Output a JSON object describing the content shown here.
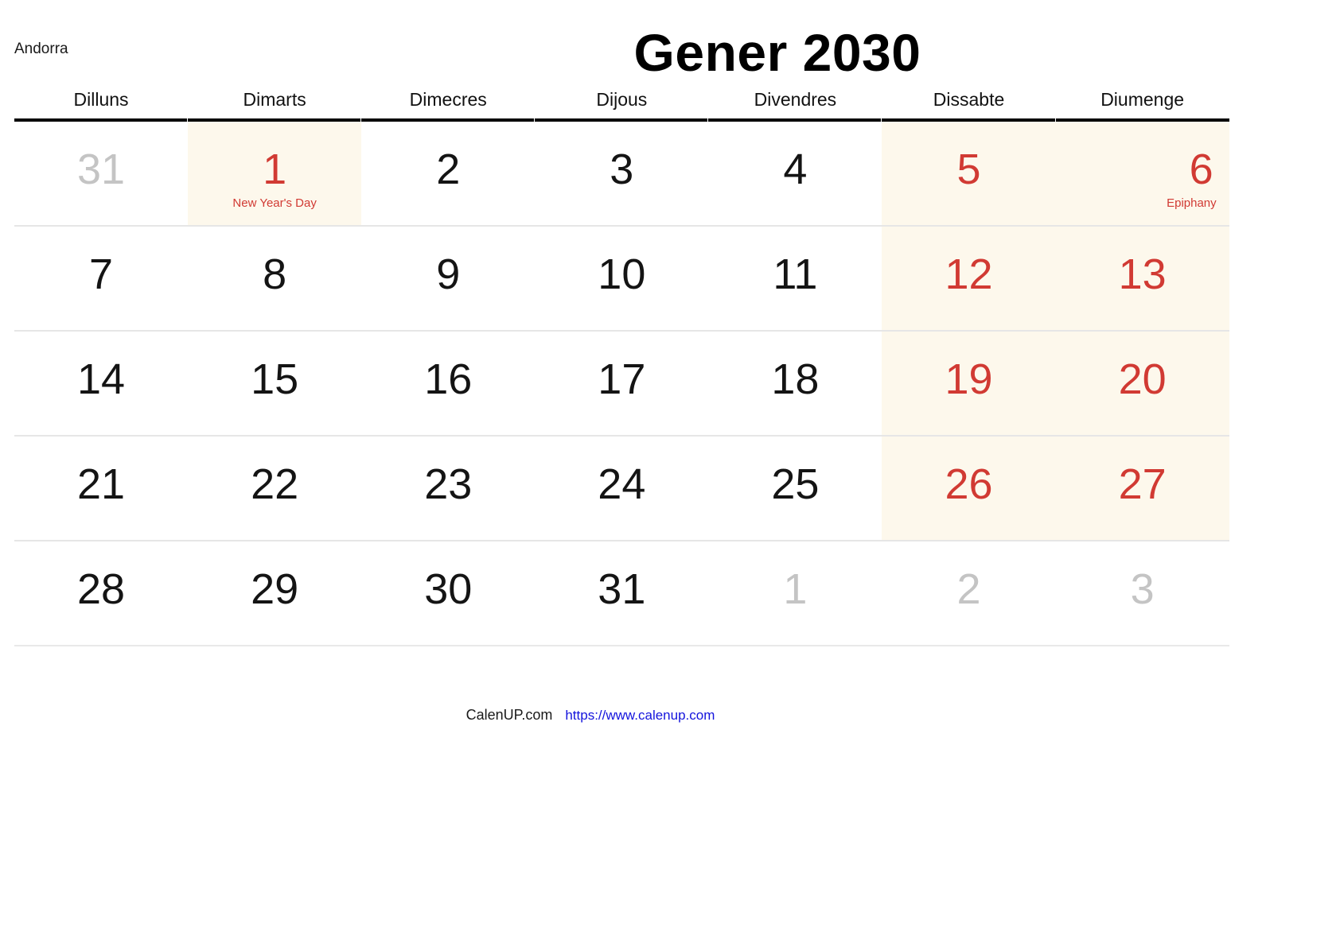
{
  "country": "Andorra",
  "title": "Gener 2030",
  "weekdays": [
    "Dilluns",
    "Dimarts",
    "Dimecres",
    "Dijous",
    "Divendres",
    "Dissabte",
    "Diumenge"
  ],
  "colors": {
    "weekend_text": "#d13a33",
    "holiday_text": "#d13a33",
    "muted_text": "#c4c4c4",
    "weekend_background": "#fdf8ec",
    "holiday_background": "#fdf8ec",
    "rule": "#000000",
    "row_divider": "#e6e6e6",
    "link": "#1414dd"
  },
  "weeks": [
    [
      {
        "day": "31",
        "muted": true,
        "weekend": false,
        "shaded": false,
        "holiday": null
      },
      {
        "day": "1",
        "muted": false,
        "weekend": false,
        "shaded": true,
        "holiday": "New Year's Day"
      },
      {
        "day": "2",
        "muted": false,
        "weekend": false,
        "shaded": false,
        "holiday": null
      },
      {
        "day": "3",
        "muted": false,
        "weekend": false,
        "shaded": false,
        "holiday": null
      },
      {
        "day": "4",
        "muted": false,
        "weekend": false,
        "shaded": false,
        "holiday": null
      },
      {
        "day": "5",
        "muted": false,
        "weekend": true,
        "shaded": true,
        "holiday": null
      },
      {
        "day": "6",
        "muted": false,
        "weekend": true,
        "shaded": true,
        "holiday": "Epiphany"
      }
    ],
    [
      {
        "day": "7",
        "muted": false,
        "weekend": false,
        "shaded": false,
        "holiday": null
      },
      {
        "day": "8",
        "muted": false,
        "weekend": false,
        "shaded": false,
        "holiday": null
      },
      {
        "day": "9",
        "muted": false,
        "weekend": false,
        "shaded": false,
        "holiday": null
      },
      {
        "day": "10",
        "muted": false,
        "weekend": false,
        "shaded": false,
        "holiday": null
      },
      {
        "day": "11",
        "muted": false,
        "weekend": false,
        "shaded": false,
        "holiday": null
      },
      {
        "day": "12",
        "muted": false,
        "weekend": true,
        "shaded": true,
        "holiday": null
      },
      {
        "day": "13",
        "muted": false,
        "weekend": true,
        "shaded": true,
        "holiday": null
      }
    ],
    [
      {
        "day": "14",
        "muted": false,
        "weekend": false,
        "shaded": false,
        "holiday": null
      },
      {
        "day": "15",
        "muted": false,
        "weekend": false,
        "shaded": false,
        "holiday": null
      },
      {
        "day": "16",
        "muted": false,
        "weekend": false,
        "shaded": false,
        "holiday": null
      },
      {
        "day": "17",
        "muted": false,
        "weekend": false,
        "shaded": false,
        "holiday": null
      },
      {
        "day": "18",
        "muted": false,
        "weekend": false,
        "shaded": false,
        "holiday": null
      },
      {
        "day": "19",
        "muted": false,
        "weekend": true,
        "shaded": true,
        "holiday": null
      },
      {
        "day": "20",
        "muted": false,
        "weekend": true,
        "shaded": true,
        "holiday": null
      }
    ],
    [
      {
        "day": "21",
        "muted": false,
        "weekend": false,
        "shaded": false,
        "holiday": null
      },
      {
        "day": "22",
        "muted": false,
        "weekend": false,
        "shaded": false,
        "holiday": null
      },
      {
        "day": "23",
        "muted": false,
        "weekend": false,
        "shaded": false,
        "holiday": null
      },
      {
        "day": "24",
        "muted": false,
        "weekend": false,
        "shaded": false,
        "holiday": null
      },
      {
        "day": "25",
        "muted": false,
        "weekend": false,
        "shaded": false,
        "holiday": null
      },
      {
        "day": "26",
        "muted": false,
        "weekend": true,
        "shaded": true,
        "holiday": null
      },
      {
        "day": "27",
        "muted": false,
        "weekend": true,
        "shaded": true,
        "holiday": null
      }
    ],
    [
      {
        "day": "28",
        "muted": false,
        "weekend": false,
        "shaded": false,
        "holiday": null
      },
      {
        "day": "29",
        "muted": false,
        "weekend": false,
        "shaded": false,
        "holiday": null
      },
      {
        "day": "30",
        "muted": false,
        "weekend": false,
        "shaded": false,
        "holiday": null
      },
      {
        "day": "31",
        "muted": false,
        "weekend": false,
        "shaded": false,
        "holiday": null
      },
      {
        "day": "1",
        "muted": true,
        "weekend": false,
        "shaded": false,
        "holiday": null
      },
      {
        "day": "2",
        "muted": true,
        "weekend": false,
        "shaded": false,
        "holiday": null
      },
      {
        "day": "3",
        "muted": true,
        "weekend": false,
        "shaded": false,
        "holiday": null
      }
    ]
  ],
  "footer": {
    "brand": "CalenUP.com",
    "url": "https://www.calenup.com"
  }
}
